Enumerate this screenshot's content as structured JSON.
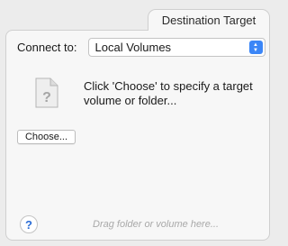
{
  "tab": {
    "label": "Destination Target"
  },
  "connect": {
    "label": "Connect to:",
    "selected": "Local Volumes",
    "accent_color": "#3b86f7"
  },
  "placeholder_icon": "document-question-icon",
  "message": "Click 'Choose' to specify a target volume or folder...",
  "choose_button": {
    "label": "Choose..."
  },
  "help_button": {
    "label": "?"
  },
  "drag_hint": "Drag folder or volume here..."
}
